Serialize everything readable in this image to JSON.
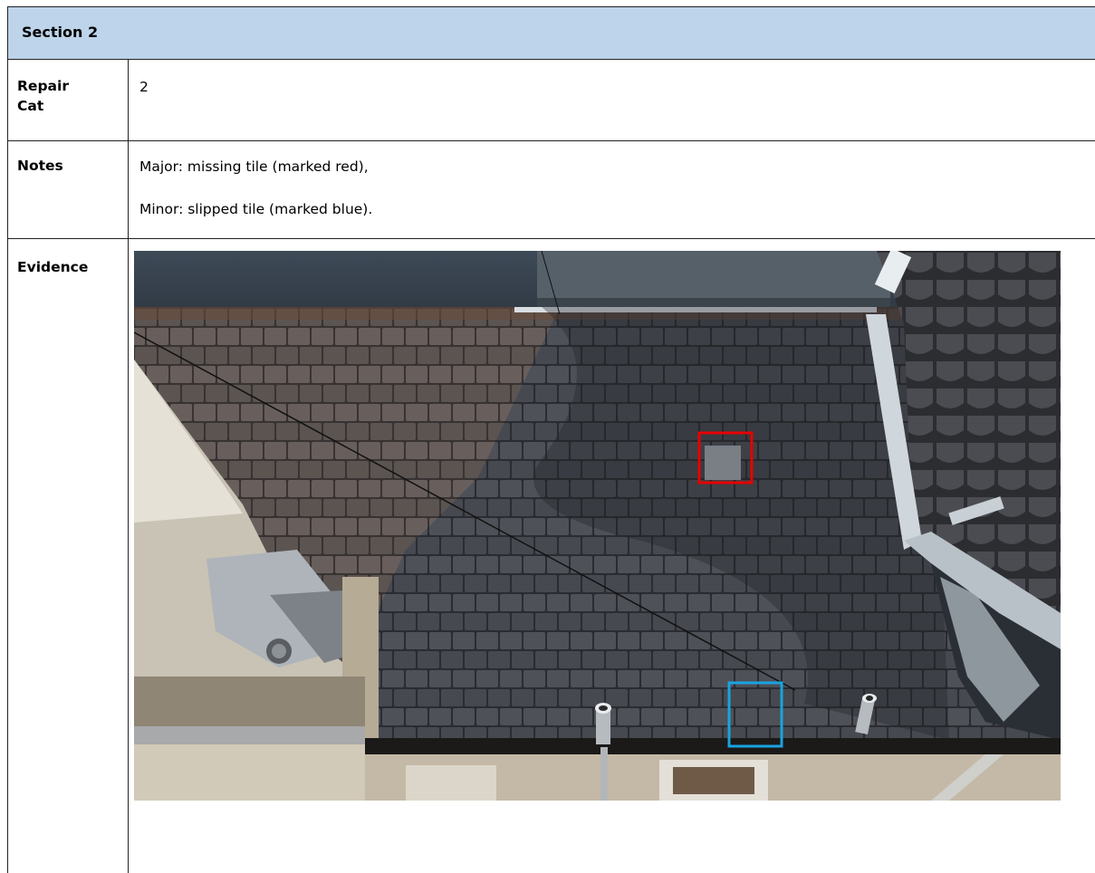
{
  "section_title": "Section 2",
  "rows": {
    "repair_cat": {
      "label": "Repair Cat",
      "value": "2"
    },
    "notes": {
      "label": "Notes",
      "lines": [
        "Major: missing tile (marked red),",
        "Minor: slipped tile (marked blue)."
      ]
    },
    "evidence": {
      "label": "Evidence"
    }
  },
  "photo": {
    "marker_colors": {
      "major": "#e60000",
      "minor": "#1aa3e0"
    }
  },
  "colors": {
    "header_bg": "#bdd4ea",
    "border": "#222222"
  }
}
